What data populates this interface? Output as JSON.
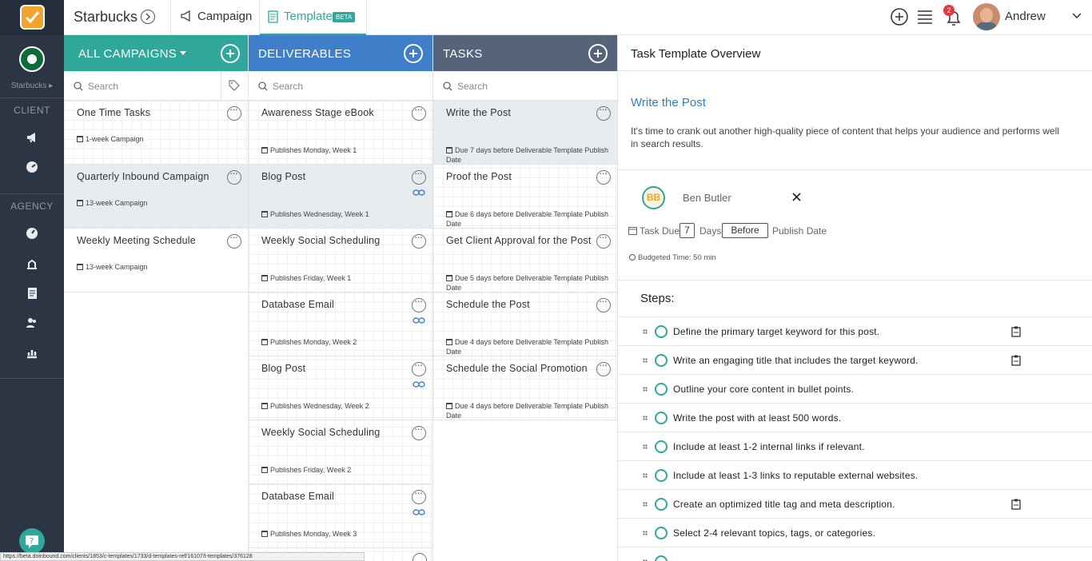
{
  "app": {
    "logo_icon": "task-check-logo"
  },
  "topbar": {
    "brand": "Starbucks",
    "tab_campaign": "Campaign",
    "tab_template": "Template",
    "tab_template_badge": "BETA",
    "notification_count": "2",
    "user_name": "Andrew"
  },
  "rail": {
    "client_name": "Starbucks ▸",
    "section_client": "CLIENT",
    "section_agency": "AGENCY"
  },
  "columns": {
    "campaigns": {
      "title": "ALL CAMPAIGNS",
      "search_placeholder": "Search",
      "items": [
        {
          "title": "One Time Tasks",
          "meta": "1-week Campaign"
        },
        {
          "title": "Quarterly Inbound Campaign",
          "meta": "13-week Campaign"
        },
        {
          "title": "Weekly Meeting Schedule",
          "meta": "13-week Campaign"
        }
      ]
    },
    "deliverables": {
      "title": "DELIVERABLES",
      "search_placeholder": "Search",
      "items": [
        {
          "title": "Awareness Stage eBook",
          "meta": "Publishes Monday, Week 1"
        },
        {
          "title": "Blog Post",
          "meta": "Publishes Wednesday, Week 1"
        },
        {
          "title": "Weekly Social Scheduling",
          "meta": "Publishes Friday, Week 1"
        },
        {
          "title": "Database Email",
          "meta": "Publishes Monday, Week 2"
        },
        {
          "title": "Blog Post",
          "meta": "Publishes Wednesday, Week 2"
        },
        {
          "title": "Weekly Social Scheduling",
          "meta": "Publishes Friday, Week 2"
        },
        {
          "title": "Database Email",
          "meta": "Publishes Monday, Week 3"
        }
      ]
    },
    "tasks": {
      "title": "TASKS",
      "search_placeholder": "Search",
      "items": [
        {
          "title": "Write the Post",
          "meta": "Due 7 days before Deliverable Template Publish Date"
        },
        {
          "title": "Proof the Post",
          "meta": "Due 6 days before Deliverable Template Publish Date"
        },
        {
          "title": "Get Client Approval for the Post",
          "meta": "Due 5 days before Deliverable Template Publish Date"
        },
        {
          "title": "Schedule the Post",
          "meta": "Due 4 days before Deliverable Template Publish Date"
        },
        {
          "title": "Schedule the Social Promotion",
          "meta": "Due 4 days before Deliverable Template Publish Date"
        }
      ]
    }
  },
  "overview": {
    "header": "Task Template Overview",
    "task_title": "Write the Post",
    "description": "It's time to crank out another high-quality piece of content that helps your audience and performs well in search results.",
    "assignee_initials": "BB",
    "assignee_name": "Ben Butler",
    "task_due_label": "Task Due",
    "task_due_days": "7",
    "days_label": "Days",
    "relation": "Before",
    "publish_label": "Publish Date",
    "budgeted_time": "Budgeted Time: 50 min",
    "steps_heading": "Steps:",
    "steps": [
      "Define the primary target keyword for this post.",
      "Write an engaging title that includes the target keyword.",
      "Outline your core content in bullet points.",
      "Write the post with at least 500 words.",
      "Include at least 1-2 internal links if relevant.",
      "Include at least 1-3 links to reputable external websites.",
      "Create an optimized title tag and meta description.",
      "Select 2-4 relevant topics, tags, or categories."
    ]
  },
  "statusbar": {
    "url": "https://beta.doinbound.com/clients/1853/c-templates/1733/d-templates-ref/16107/t-templates/376128"
  },
  "colors": {
    "teal": "#2fa79a",
    "blue": "#3f7fc9",
    "slate": "#55647a",
    "rail": "#2b3544",
    "link_blue": "#2f80c4"
  }
}
